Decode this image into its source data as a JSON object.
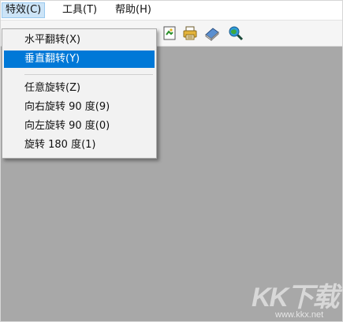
{
  "menubar": {
    "items": [
      {
        "label": "特效(C)",
        "active": true
      },
      {
        "label": "工具(T)",
        "active": false
      },
      {
        "label": "帮助(H)",
        "active": false
      }
    ]
  },
  "toolbar": {
    "icons": [
      "image-edit-icon",
      "printer-icon",
      "book-icon",
      "zoom-globe-icon"
    ]
  },
  "dropdown": {
    "groups": [
      [
        {
          "label": "水平翻转(X)",
          "highlighted": false
        },
        {
          "label": "垂直翻转(Y)",
          "highlighted": true
        }
      ],
      [
        {
          "label": "任意旋转(Z)",
          "highlighted": false
        },
        {
          "label": "向右旋转 90 度(9)",
          "highlighted": false
        },
        {
          "label": "向左旋转 90 度(0)",
          "highlighted": false
        },
        {
          "label": "旋转 180 度(1)",
          "highlighted": false
        }
      ]
    ]
  },
  "watermark": {
    "logo": "KK下载",
    "url": "www.kkx.net"
  },
  "colors": {
    "highlight": "#0078d7",
    "canvas": "#a8a8a8",
    "menu_active": "#cce4f7"
  }
}
